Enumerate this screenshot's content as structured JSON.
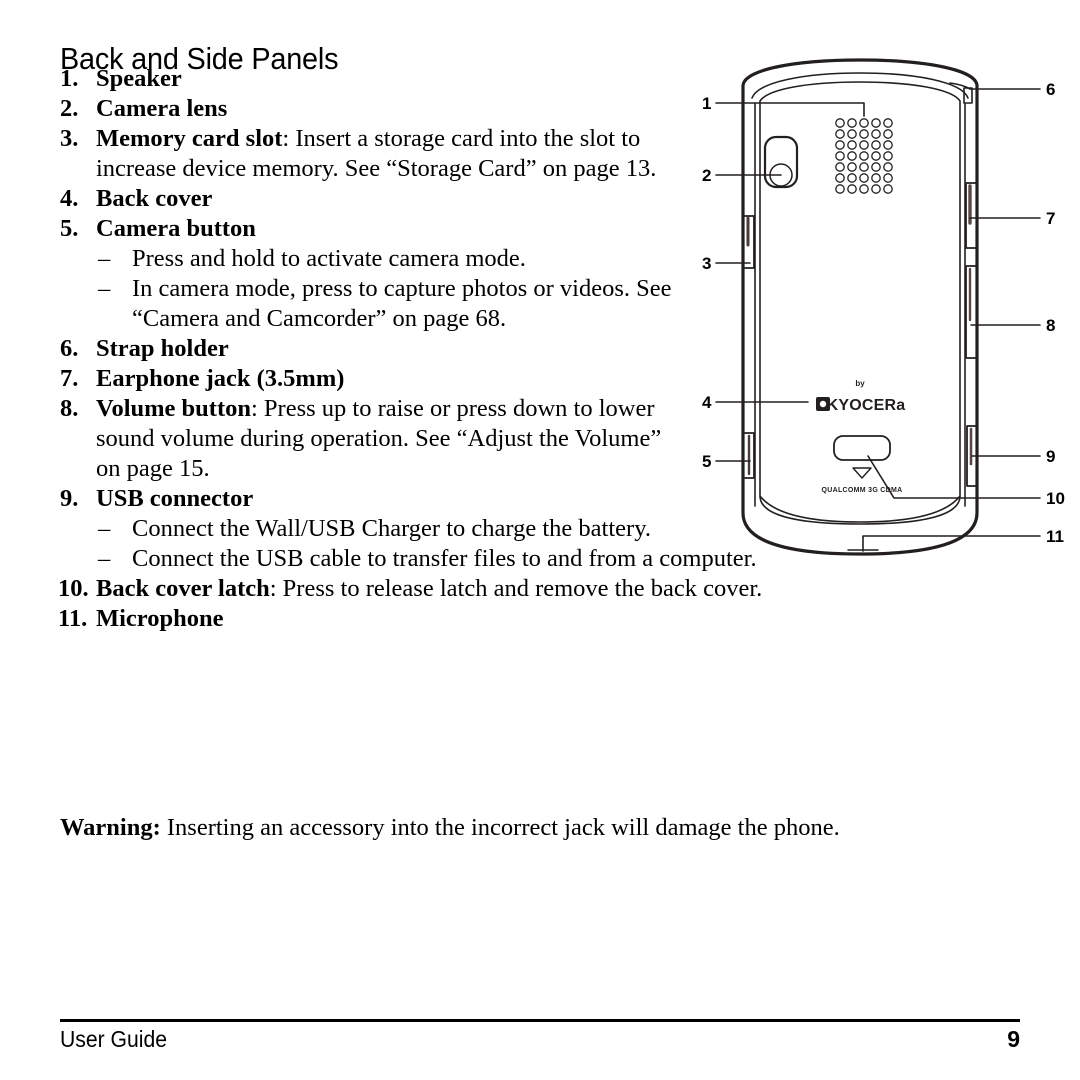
{
  "document": {
    "heading": "Back and Side Panels",
    "footer": {
      "left": "User Guide",
      "page_number": "9"
    }
  },
  "list": {
    "items": [
      {
        "num": "1.",
        "term": "Speaker",
        "rest": ""
      },
      {
        "num": "2.",
        "term": "Camera lens",
        "rest": ""
      },
      {
        "num": "3.",
        "term": "Memory card slot",
        "rest": ": Insert a storage card into the slot to increase device memory. See “Storage Card” on page 13."
      },
      {
        "num": "4.",
        "term": "Back cover",
        "rest": ""
      },
      {
        "num": "5.",
        "term": "Camera button",
        "rest": ""
      },
      {
        "num": "6.",
        "term": "Strap holder",
        "rest": ""
      },
      {
        "num": "7.",
        "term": "Earphone jack (3.5mm)",
        "rest": ""
      },
      {
        "num": "8.",
        "term": "Volume button",
        "rest": ": Press up to raise or press down to lower sound volume during operation. See “Adjust the Volume” on page 15."
      },
      {
        "num": "9.",
        "term": "USB connector",
        "rest": ""
      },
      {
        "num": "10.",
        "term": "Back cover latch",
        "rest": ": Press to release latch and remove the back cover."
      },
      {
        "num": "11.",
        "term": "Microphone",
        "rest": ""
      }
    ],
    "sub_item_5_a": "Press and hold to activate camera mode.",
    "sub_item_5_b": "In camera mode, press to capture photos or videos. See “Camera and Camcorder” on page 68.",
    "sub_item_9_a": "Connect the Wall/USB Charger to charge the battery.",
    "sub_item_9_b": "Connect the USB cable to transfer files to and from a computer.",
    "dash": "–"
  },
  "warning": {
    "label": "Warning:",
    "text": " Inserting an accessory into the incorrect jack will damage the phone."
  },
  "figure": {
    "title": "phone-back-panel-diagram",
    "brand_by": "by",
    "brand_name": "KYOCERa",
    "brand_sub": "QUALCOMM 3G CDMA",
    "callouts": [
      {
        "id": "1",
        "label": "1",
        "target": "speaker"
      },
      {
        "id": "2",
        "label": "2",
        "target": "camera-lens"
      },
      {
        "id": "3",
        "label": "3",
        "target": "memory-card-slot"
      },
      {
        "id": "4",
        "label": "4",
        "target": "back-cover"
      },
      {
        "id": "5",
        "label": "5",
        "target": "camera-button"
      },
      {
        "id": "6",
        "label": "6",
        "target": "strap-holder"
      },
      {
        "id": "7",
        "label": "7",
        "target": "earphone-jack"
      },
      {
        "id": "8",
        "label": "8",
        "target": "volume-button"
      },
      {
        "id": "9",
        "label": "9",
        "target": "usb-connector"
      },
      {
        "id": "10",
        "label": "10",
        "target": "back-cover-latch"
      },
      {
        "id": "11",
        "label": "11",
        "target": "microphone"
      }
    ],
    "speaker_grille": {
      "rows": 7,
      "cols": 5
    },
    "colors": {
      "outline": "#231f20",
      "page_bg": "#ffffff",
      "text": "#000000"
    }
  }
}
